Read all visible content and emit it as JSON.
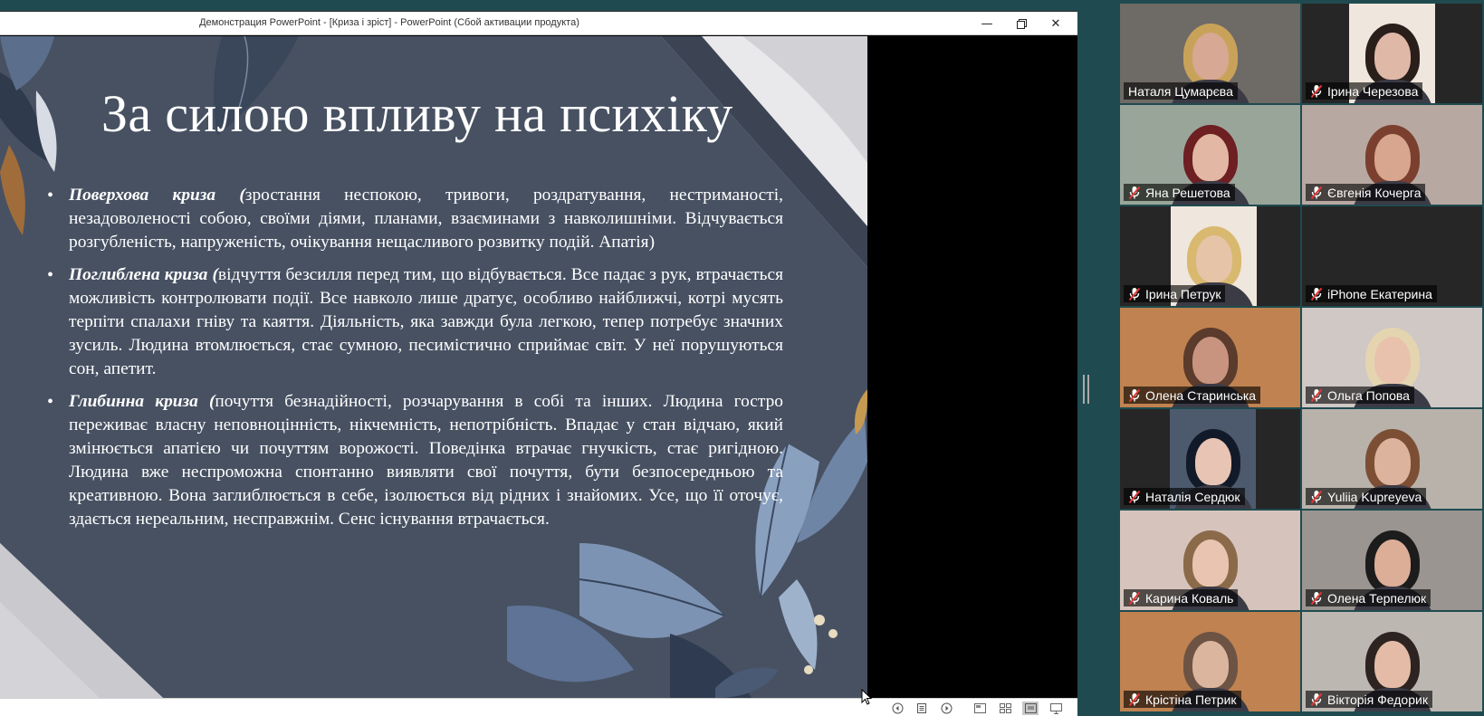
{
  "window": {
    "title": "Демонстрация PowerPoint - [Криза і зріст] - PowerPoint (Сбой активации продукта)",
    "minimize_icon": "minimize-icon",
    "restore_icon": "restore-icon",
    "close_icon": "close-icon"
  },
  "slide": {
    "title": "За силою впливу на психіку",
    "bullets": [
      {
        "term": "Поверхова криза (",
        "text": "зростання неспокою, тривоги, роздратування, нестриманості, незадоволеності собою, своїми діями, планами, взаєминами з навколишніми. Відчувається розгубленість, напруженість, очікування нещасливого розвитку подій. Апатія)"
      },
      {
        "term": "Поглиблена криза (",
        "text": "відчуття безсилля перед тим, що відбувається. Все падає з рук, втрачається можливість контролювати події. Все навколо лише дратує, особливо найближчі, котрі мусять терпіти спалахи гніву та каяття. Діяльність, яка завжди була легкою, тепер потребує значних зусиль. Людина втомлюється, стає сумною, песимістично сприймає світ. У неї порушуються сон, апетит."
      },
      {
        "term": "Глибинна криза (",
        "text": "почуття безнадійності, розчарування в собі та інших. Людина гостро переживає власну неповноцінність, нікчемність, непотрібність. Впадає у стан відчаю, який змінюється апатією чи почуттям ворожості. Поведінка втрачає гнучкість, стає ригідною. Людина вже неспроможна спонтанно виявляти свої почуття, бути безпосередньою та креативною. Вона заглиблюється в себе, ізолюється від рідних і знайомих. Усе, що її оточує, здається нереальним, несправжнім. Сенс існування втрачається."
      }
    ]
  },
  "statusbar": {
    "icons": [
      "prev-slide-icon",
      "slide-menu-icon",
      "next-slide-icon",
      "normal-view-icon",
      "slide-sorter-icon",
      "reading-view-icon",
      "slideshow-icon"
    ]
  },
  "participants": [
    {
      "name": "Наталя Цумарєва",
      "muted": false,
      "active": true,
      "bg": "#6e6a66",
      "face": "#d7a894",
      "hair": "#c9a25a"
    },
    {
      "name": "Ірина Черезова",
      "muted": true,
      "active": false,
      "bg": "#262626",
      "face": "#e0b8a8",
      "hair": "#2a1e1a"
    },
    {
      "name": "Яна Решетова",
      "muted": true,
      "active": false,
      "bg": "#9aa59a",
      "face": "#e2b7a3",
      "hair": "#6d1f22"
    },
    {
      "name": "Євгенія Кочерга",
      "muted": true,
      "active": false,
      "bg": "#b8a8a2",
      "face": "#d8a58e",
      "hair": "#7a3f2e"
    },
    {
      "name": "Ірина Петрук",
      "muted": true,
      "active": false,
      "bg": "#262626",
      "face": "#e6c4a8",
      "hair": "#d9b870"
    },
    {
      "name": "iPhone Екатерина",
      "muted": true,
      "active": false,
      "bg": "#262626",
      "face": "",
      "hair": ""
    },
    {
      "name": "Олена Старинська",
      "muted": true,
      "active": false,
      "bg": "#c08250",
      "face": "#c89480",
      "hair": "#5a3b2c"
    },
    {
      "name": "Ольга Попова",
      "muted": true,
      "active": false,
      "bg": "#cfc8c4",
      "face": "#e8c2ac",
      "hair": "#e4d5b0"
    },
    {
      "name": "Наталія Сердюк",
      "muted": true,
      "active": false,
      "bg": "#262626",
      "face": "#e8c4b4",
      "hair": "#121a2a"
    },
    {
      "name": "Yuliia Kupreyeva",
      "muted": true,
      "active": false,
      "bg": "#b9b2aa",
      "face": "#dcb39c",
      "hair": "#7c4f34"
    },
    {
      "name": "Карина Коваль",
      "muted": true,
      "active": false,
      "bg": "#d6c4bc",
      "face": "#e9c4b0",
      "hair": "#8b6a4a"
    },
    {
      "name": "Олена Терпелюк",
      "muted": true,
      "active": false,
      "bg": "#9a9590",
      "face": "#dcae98",
      "hair": "#1c1c1c"
    },
    {
      "name": "Крістіна Петрик",
      "muted": true,
      "active": false,
      "bg": "#c08250",
      "face": "#dcb59e",
      "hair": "#6d5344"
    },
    {
      "name": "Вікторія Федорик",
      "muted": true,
      "active": false,
      "bg": "#bdb7b2",
      "face": "#e3bba6",
      "hair": "#2d2320"
    }
  ]
}
